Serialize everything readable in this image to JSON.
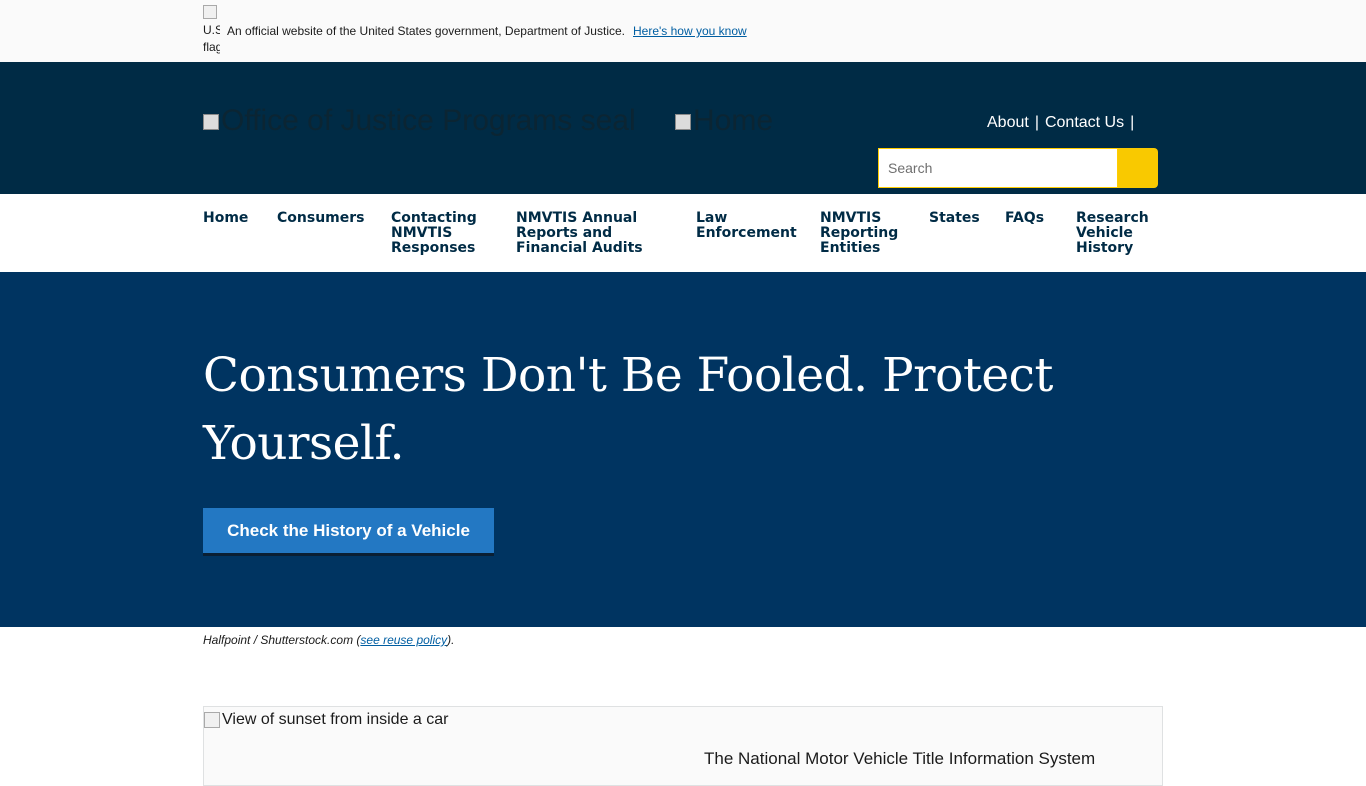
{
  "gov_banner": {
    "flag_alt": "U.S. flag",
    "text": "An official website of the United States government, Department of Justice.",
    "link": "Here's how you know"
  },
  "header": {
    "seal_alt": "Office of Justice Programs seal",
    "home_alt": "Home",
    "util_nav": [
      "About",
      "Contact Us"
    ],
    "search_placeholder": "Search"
  },
  "nav": {
    "items": [
      "Home",
      "Consumers",
      "Contacting NMVTIS Responses",
      "NMVTIS Annual Reports and Financial Audits",
      "Law Enforcement",
      "NMVTIS Reporting Entities",
      "States",
      "FAQs",
      "Research Vehicle History"
    ]
  },
  "hero": {
    "title": "Consumers Don't Be Fooled. Protect Yourself.",
    "button": "Check the History of a Vehicle"
  },
  "credit": {
    "text": "Halfpoint / Shutterstock.com (",
    "link": "see reuse policy",
    "end": ")."
  },
  "card": {
    "img_alt": "View of sunset from inside a car",
    "text": "The National Motor Vehicle Title Information System"
  },
  "colors": {
    "header_bg": "#002b45",
    "hero_bg": "#003461",
    "accent_yellow": "#f9c900",
    "button_blue": "#2378c3"
  }
}
